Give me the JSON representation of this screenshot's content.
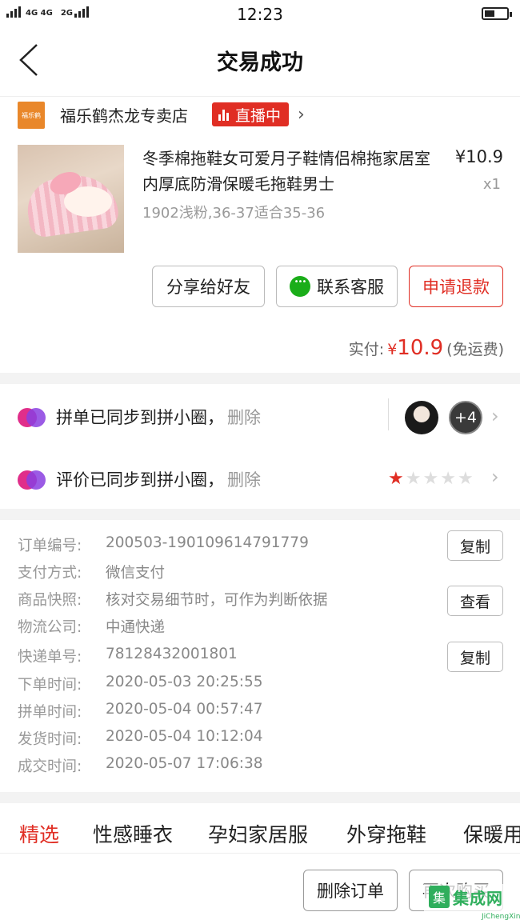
{
  "status_bar": {
    "network": "4G 4G",
    "network2": "2G",
    "time": "12:23"
  },
  "nav": {
    "title": "交易成功"
  },
  "shop": {
    "logo_text": "福乐鹤",
    "name": "福乐鹤杰龙专卖店",
    "live_label": "直播中"
  },
  "product": {
    "title": "冬季棉拖鞋女可爱月子鞋情侣棉拖家居室内厚底防滑保暖毛拖鞋男士",
    "price": "¥10.9",
    "qty": "x1",
    "spec": "1902浅粉,36-37适合35-36"
  },
  "actions": {
    "share": "分享给好友",
    "service": "联系客服",
    "refund": "申请退款"
  },
  "payment": {
    "label": "实付:",
    "currency": "¥",
    "amount": "10.9",
    "shipping": "(免运费)"
  },
  "sync": [
    {
      "text": "拼单已同步到拼小圈，",
      "delete": "删除",
      "more_count": "+4"
    },
    {
      "text": "评价已同步到拼小圈，",
      "delete": "删除",
      "rating": 1,
      "rating_max": 5
    }
  ],
  "order_info": [
    {
      "key": "订单编号:",
      "value": "200503-190109614791779",
      "button": "复制"
    },
    {
      "key": "支付方式:",
      "value": "微信支付"
    },
    {
      "key": "商品快照:",
      "value": "核对交易细节时，可作为判断依据",
      "button": "查看"
    },
    {
      "key": "物流公司:",
      "value": "中通快递"
    },
    {
      "key": "快递单号:",
      "value": "78128432001801",
      "button": "复制"
    },
    {
      "key": "下单时间:",
      "value": "2020-05-03 20:25:55"
    },
    {
      "key": "拼单时间:",
      "value": "2020-05-04 00:57:47"
    },
    {
      "key": "发货时间:",
      "value": "2020-05-04 10:12:04"
    },
    {
      "key": "成交时间:",
      "value": "2020-05-07 17:06:38"
    }
  ],
  "tabs": [
    "精选",
    "性感睡衣",
    "孕妇家居服",
    "外穿拖鞋",
    "保暖用"
  ],
  "bottom": {
    "delete_order": "删除订单",
    "buy_again": "再次购买"
  },
  "watermark": {
    "logo": "集",
    "name": "集成网",
    "url": "JiChengXin.com"
  },
  "colors": {
    "accent": "#e02e24",
    "wechat": "#1aad19",
    "watermark": "#2fae5c"
  }
}
